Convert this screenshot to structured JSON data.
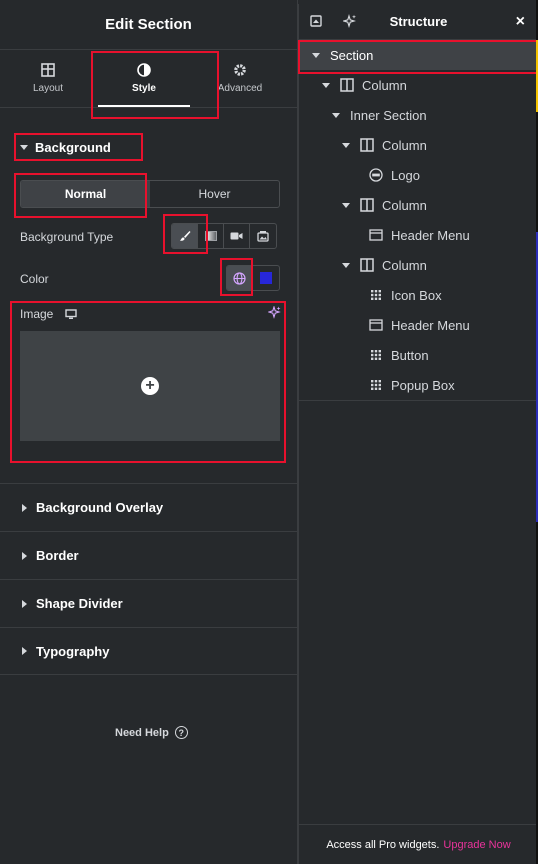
{
  "left": {
    "title": "Edit Section",
    "tabs": [
      {
        "label": "Layout",
        "icon": "layout-icon"
      },
      {
        "label": "Style",
        "icon": "contrast-icon",
        "active": true
      },
      {
        "label": "Advanced",
        "icon": "gear-icon"
      }
    ],
    "background": {
      "title": "Background",
      "state_tabs": [
        "Normal",
        "Hover"
      ],
      "background_type_label": "Background Type",
      "color_label": "Color",
      "image_label": "Image"
    },
    "collapsed_sections": [
      "Background Overlay",
      "Border",
      "Shape Divider",
      "Typography"
    ],
    "help_label": "Need Help",
    "colors": {
      "accent_red": "#e8112d",
      "swatch_blue": "#2727d9"
    }
  },
  "structure": {
    "title": "Structure",
    "items": [
      {
        "label": "Section",
        "icon": "caret",
        "selected": true
      },
      {
        "label": "Column",
        "icon": "column-icon"
      },
      {
        "label": "Inner Section",
        "icon": "caret"
      },
      {
        "label": "Column",
        "icon": "column-icon"
      },
      {
        "label": "Logo",
        "icon": "logo-icon"
      },
      {
        "label": "Column",
        "icon": "column-icon"
      },
      {
        "label": "Header Menu",
        "icon": "header-menu-icon"
      },
      {
        "label": "Column",
        "icon": "column-icon"
      },
      {
        "label": "Icon Box",
        "icon": "grid-icon"
      },
      {
        "label": "Header Menu",
        "icon": "header-menu-icon"
      },
      {
        "label": "Button",
        "icon": "grid-icon"
      },
      {
        "label": "Popup Box",
        "icon": "grid-icon"
      }
    ],
    "footer_text": "Access all Pro widgets.",
    "footer_link": "Upgrade Now"
  }
}
